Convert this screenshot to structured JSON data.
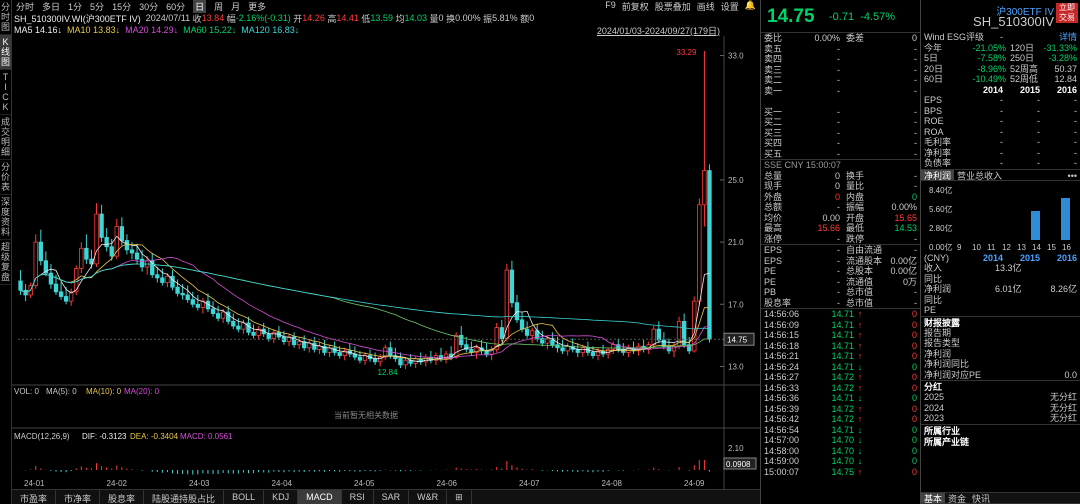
{
  "left_tabs": [
    "分时图",
    "K线图",
    "TICK",
    "成交明细",
    "分价表",
    "深度资料",
    "超级复盘"
  ],
  "topbar": {
    "periods": [
      "分时",
      "多日",
      "1分",
      "5分",
      "15分",
      "30分",
      "60分",
      "日",
      "周",
      "月",
      "更多"
    ],
    "active": "日",
    "tools": [
      "F9",
      "前复权",
      "股票叠加",
      "画线",
      "设置"
    ]
  },
  "quote_line": {
    "name": "SH_510300IV.WI(沪300ETF IV)",
    "date": "2024/07/11",
    "shou_l": "收",
    "shou": "13.84",
    "fu_l": "幅",
    "fu": "-2.16%(-0.31)",
    "kai_l": "开",
    "kai": "14.26",
    "gao_l": "高",
    "gao": "14.41",
    "di_l": "低",
    "di": "13.59",
    "jun_l": "均",
    "jun": "14.03",
    "liang_l": "量",
    "liang": "0",
    "huan_l": "换",
    "huan": "0.00%",
    "zhen_l": "振",
    "zhen": "5.81%",
    "e_l": "额",
    "e": "0"
  },
  "ma_line": {
    "ma5": "MA5 14.16↓",
    "ma10": "MA10 13.83↓",
    "ma20": "MA20 14.29↓",
    "ma60": "MA60 15.22↓",
    "ma120": "MA120 16.83↓",
    "range": "2024/01/03-2024/09/27(179日)"
  },
  "yaxis": [
    "33.0",
    "25.0",
    "21.0",
    "17.0",
    "13.0"
  ],
  "labels": {
    "hi": "33.29",
    "lo": "12.84",
    "cur": "14.75"
  },
  "vol": {
    "title": "VOL: 0",
    "ma5": "MA(5): 0",
    "ma10": "MA(10): 0",
    "ma20": "MA(20): 0",
    "empty": "当前暂无相关数据"
  },
  "macd": {
    "title": "MACD(12,26,9)",
    "dif": "DIF: -0.3123",
    "dea": "DEA: -0.3404",
    "macd": "MACD: 0.0561",
    "y1": "2.10",
    "y2": "0.0908"
  },
  "xaxis": [
    "24-01",
    "24-02",
    "24-03",
    "24-04",
    "24-05",
    "24-06",
    "24-07",
    "24-08",
    "24-09"
  ],
  "bottom_tabs": [
    "市盈率",
    "市净率",
    "股息率",
    "陆股通持股占比",
    "BOLL",
    "KDJ",
    "MACD",
    "RSI",
    "SAR",
    "W&R"
  ],
  "bottom_active": "MACD",
  "header": {
    "price": "14.75",
    "change": "-0.71",
    "pct": "-4.57%",
    "title": "沪300ETF IV",
    "code": "SH_510300IV",
    "badge": "立即交易"
  },
  "order": [
    {
      "a": "委比",
      "b": "0.00%",
      "c": "委差",
      "d": "0"
    },
    {
      "a": "卖五",
      "b": "-",
      "c": "",
      "d": "-"
    },
    {
      "a": "卖四",
      "b": "-",
      "c": "",
      "d": "-"
    },
    {
      "a": "卖三",
      "b": "-",
      "c": "",
      "d": "-"
    },
    {
      "a": "卖二",
      "b": "-",
      "c": "",
      "d": "-"
    },
    {
      "a": "卖一",
      "b": "-",
      "c": "",
      "d": "-"
    },
    {
      "a": "",
      "b": "",
      "c": "",
      "d": ""
    },
    {
      "a": "买一",
      "b": "-",
      "c": "",
      "d": "-"
    },
    {
      "a": "买二",
      "b": "-",
      "c": "",
      "d": "-"
    },
    {
      "a": "买三",
      "b": "-",
      "c": "",
      "d": "-"
    },
    {
      "a": "买四",
      "b": "-",
      "c": "",
      "d": "-"
    },
    {
      "a": "买五",
      "b": "-",
      "c": "",
      "d": "-"
    }
  ],
  "stats": [
    {
      "a": "总量",
      "b": "0",
      "c": "换手",
      "d": "-"
    },
    {
      "a": "现手",
      "b": "0",
      "c": "量比",
      "d": "-"
    },
    {
      "a": "外盘",
      "b": "0",
      "c": "内盘",
      "d": "0"
    },
    {
      "a": "总额",
      "b": "-",
      "c": "振幅",
      "d": "0.00%"
    },
    {
      "a": "均价",
      "b": "0.00",
      "c": "开盘",
      "d": "15.65"
    },
    {
      "a": "最高",
      "b": "15.66",
      "c": "最低",
      "d": "14.53"
    },
    {
      "a": "涨停",
      "b": "-",
      "c": "跌停",
      "d": "-"
    }
  ],
  "fin": [
    {
      "a": "EPS",
      "b": "-",
      "c": "自由流通",
      "d": "-"
    },
    {
      "a": "EPS",
      "b": "-",
      "c": "流通股本",
      "d": "0.00亿"
    },
    {
      "a": "PE",
      "b": "-",
      "c": "总股本",
      "d": "0.00亿"
    },
    {
      "a": "PE",
      "b": "-",
      "c": "流通值",
      "d": "0万"
    },
    {
      "a": "PB",
      "b": "-",
      "c": "总市值",
      "d": "-"
    },
    {
      "a": "股息率",
      "b": "-",
      "c": "总市值",
      "d": "-"
    }
  ],
  "ssebar": "SSE  CNY  15:00:07",
  "ticks": [
    {
      "t": "14:56:06",
      "p": "14.71",
      "a": "↑",
      "v": "0"
    },
    {
      "t": "14:56:09",
      "p": "14.71",
      "a": "↑",
      "v": "0"
    },
    {
      "t": "14:56:15",
      "p": "14.71",
      "a": "↑",
      "v": "0"
    },
    {
      "t": "14:56:18",
      "p": "14.71",
      "a": "↑",
      "v": "0"
    },
    {
      "t": "14:56:21",
      "p": "14.71",
      "a": "↑",
      "v": "0"
    },
    {
      "t": "14:56:24",
      "p": "14.71",
      "a": "↓",
      "v": "0"
    },
    {
      "t": "14:56:27",
      "p": "14.72",
      "a": "↑",
      "v": "0"
    },
    {
      "t": "14:56:33",
      "p": "14.72",
      "a": "↑",
      "v": "0"
    },
    {
      "t": "14:56:36",
      "p": "14.71",
      "a": "↓",
      "v": "0"
    },
    {
      "t": "14:56:39",
      "p": "14.72",
      "a": "↑",
      "v": "0"
    },
    {
      "t": "14:56:42",
      "p": "14.72",
      "a": "↑",
      "v": "0"
    },
    {
      "t": "14:56:54",
      "p": "14.71",
      "a": "↓",
      "v": "0"
    },
    {
      "t": "14:57:00",
      "p": "14.70",
      "a": "↓",
      "v": "0"
    },
    {
      "t": "14:58:00",
      "p": "14.70",
      "a": "↓",
      "v": "0"
    },
    {
      "t": "14:59:00",
      "p": "14.70",
      "a": "↓",
      "v": "0"
    },
    {
      "t": "15:00:07",
      "p": "14.75",
      "a": "↑",
      "v": "0"
    }
  ],
  "far": {
    "esg_label": "Wind ESG评级",
    "esg_val": "-",
    "detail": "详情",
    "perf": [
      {
        "a": "今年",
        "b": "-21.05%",
        "c": "120日",
        "d": "-31.33%"
      },
      {
        "a": "5日",
        "b": "-7.58%",
        "c": "250日",
        "d": "-3.28%"
      },
      {
        "a": "20日",
        "b": "-8.96%",
        "c": "52周高",
        "d": "50.37"
      },
      {
        "a": "60日",
        "b": "-10.49%",
        "c": "52周低",
        "d": "12.84"
      }
    ],
    "years": [
      "2014",
      "2015",
      "2016"
    ],
    "ratios": [
      "EPS",
      "BPS",
      "ROE",
      "ROA",
      "毛利率",
      "净利率",
      "负债率"
    ],
    "tabs": [
      "净利润",
      "营业总收入"
    ],
    "bar_y": [
      "8.40亿",
      "5.60亿",
      "2.80亿",
      "0.00亿"
    ],
    "bar_x": [
      "9",
      "10",
      "11",
      "12",
      "13",
      "14",
      "15",
      "16"
    ],
    "bar_vals": [
      0,
      0,
      0,
      0,
      0,
      4.4,
      0,
      6.2
    ],
    "cny": "(CNY)",
    "incl": [
      {
        "a": "收入",
        "v": "13.3亿"
      },
      {
        "a": "同比",
        "v": ""
      },
      {
        "a": "净利润",
        "v": "6.01亿",
        "v2": "8.26亿"
      },
      {
        "a": "同比",
        "v": ""
      },
      {
        "a": "PE",
        "v": ""
      }
    ],
    "disc_title": "财报披露",
    "disc": [
      {
        "a": "报告期",
        "v": ""
      },
      {
        "a": "报告类型",
        "v": ""
      },
      {
        "a": "净利润",
        "v": ""
      },
      {
        "a": "净利润同比",
        "v": ""
      },
      {
        "a": "净利润对应PE",
        "v": "0.0"
      }
    ],
    "div_title": "分红",
    "div": [
      {
        "a": "2025",
        "v": "无分红"
      },
      {
        "a": "2024",
        "v": "无分红"
      },
      {
        "a": "2023",
        "v": "无分红"
      }
    ],
    "ind_title": "所属行业",
    "chain_title": "所属产业链",
    "main_title": "主营业务",
    "btabs": [
      "基本",
      "资金",
      "快讯"
    ]
  },
  "colors": {
    "up": "#ff3b3b",
    "down": "#00d26a",
    "ma5": "#eeeeee",
    "ma10": "#e6c84c",
    "ma20": "#d64cd6",
    "ma60": "#6cc86c",
    "ma120": "#3cd6d6"
  },
  "chart_data": {
    "type": "candlestick",
    "ylim": [
      12,
      34
    ],
    "candles": [
      [
        18.5,
        19.2,
        17.6,
        17.9
      ],
      [
        17.9,
        18.3,
        17.2,
        17.6
      ],
      [
        17.6,
        18.4,
        17.4,
        18.2
      ],
      [
        18.2,
        21.5,
        18.0,
        21.0
      ],
      [
        21.0,
        21.8,
        19.5,
        19.8
      ],
      [
        19.8,
        20.4,
        18.8,
        19.0
      ],
      [
        19.0,
        19.6,
        18.0,
        18.3
      ],
      [
        18.3,
        18.9,
        17.6,
        17.8
      ],
      [
        17.8,
        18.4,
        17.3,
        17.5
      ],
      [
        17.5,
        18.1,
        17.0,
        17.2
      ],
      [
        17.2,
        18.0,
        16.9,
        17.8
      ],
      [
        17.8,
        19.5,
        17.6,
        19.3
      ],
      [
        19.3,
        21.0,
        19.0,
        20.6
      ],
      [
        20.6,
        21.5,
        19.6,
        19.9
      ],
      [
        19.9,
        20.5,
        19.3,
        19.6
      ],
      [
        19.6,
        23.5,
        19.4,
        22.8
      ],
      [
        22.8,
        23.4,
        21.0,
        21.3
      ],
      [
        21.3,
        21.9,
        20.4,
        20.7
      ],
      [
        20.7,
        21.2,
        19.8,
        20.1
      ],
      [
        20.1,
        22.5,
        19.9,
        22.0
      ],
      [
        22.0,
        22.6,
        20.8,
        21.1
      ],
      [
        21.1,
        21.5,
        20.2,
        20.5
      ],
      [
        20.5,
        21.0,
        19.9,
        20.3
      ],
      [
        20.3,
        20.9,
        19.6,
        19.9
      ],
      [
        19.9,
        20.5,
        19.1,
        19.4
      ],
      [
        19.4,
        20.1,
        18.9,
        19.8
      ],
      [
        19.8,
        20.3,
        18.7,
        18.9
      ],
      [
        18.9,
        19.4,
        18.4,
        18.7
      ],
      [
        18.7,
        19.3,
        18.2,
        18.4
      ],
      [
        18.4,
        19.0,
        18.1,
        18.8
      ],
      [
        18.8,
        19.2,
        17.9,
        18.1
      ],
      [
        18.1,
        18.6,
        17.5,
        17.7
      ],
      [
        17.7,
        18.3,
        17.3,
        17.6
      ],
      [
        17.6,
        18.2,
        17.1,
        17.3
      ],
      [
        17.3,
        17.8,
        16.8,
        17.0
      ],
      [
        17.0,
        17.6,
        16.6,
        16.8
      ],
      [
        16.8,
        17.4,
        16.4,
        17.2
      ],
      [
        17.2,
        17.7,
        16.5,
        16.7
      ],
      [
        16.7,
        17.2,
        16.2,
        16.4
      ],
      [
        16.4,
        16.9,
        15.9,
        16.1
      ],
      [
        16.1,
        16.7,
        15.8,
        16.5
      ],
      [
        16.5,
        16.9,
        15.7,
        15.9
      ],
      [
        15.9,
        16.4,
        15.4,
        15.6
      ],
      [
        15.6,
        16.1,
        15.2,
        15.4
      ],
      [
        15.4,
        16.0,
        15.1,
        15.8
      ],
      [
        15.8,
        16.2,
        15.0,
        15.2
      ],
      [
        15.2,
        15.7,
        14.8,
        15.0
      ],
      [
        15.0,
        15.6,
        14.7,
        15.4
      ],
      [
        15.4,
        15.8,
        14.9,
        15.1
      ],
      [
        15.1,
        15.5,
        14.6,
        14.8
      ],
      [
        14.8,
        15.4,
        14.5,
        15.2
      ],
      [
        15.2,
        15.6,
        14.7,
        14.9
      ],
      [
        14.9,
        15.3,
        14.4,
        14.6
      ],
      [
        14.6,
        15.1,
        14.3,
        14.9
      ],
      [
        14.9,
        15.2,
        14.2,
        14.4
      ],
      [
        14.4,
        14.9,
        14.1,
        14.6
      ],
      [
        14.6,
        15.0,
        14.0,
        14.2
      ],
      [
        14.2,
        14.7,
        13.9,
        14.5
      ],
      [
        14.5,
        14.9,
        13.9,
        14.1
      ],
      [
        14.1,
        14.6,
        13.8,
        14.3
      ],
      [
        14.3,
        14.7,
        13.7,
        13.9
      ],
      [
        13.9,
        14.4,
        13.6,
        14.2
      ],
      [
        14.2,
        14.6,
        13.7,
        13.9
      ],
      [
        13.9,
        14.3,
        13.5,
        13.7
      ],
      [
        13.7,
        14.2,
        13.4,
        14.0
      ],
      [
        14.0,
        14.5,
        13.6,
        13.8
      ],
      [
        13.8,
        14.3,
        13.4,
        13.6
      ],
      [
        13.6,
        14.0,
        13.2,
        13.4
      ],
      [
        13.4,
        13.9,
        13.1,
        13.7
      ],
      [
        13.7,
        14.1,
        13.3,
        13.5
      ],
      [
        13.5,
        13.9,
        13.1,
        13.3
      ],
      [
        13.3,
        13.8,
        13.0,
        13.6
      ],
      [
        13.6,
        14.4,
        13.4,
        14.2
      ],
      [
        14.2,
        14.6,
        13.5,
        13.7
      ],
      [
        13.7,
        14.2,
        13.3,
        13.5
      ],
      [
        13.5,
        13.9,
        12.9,
        13.1
      ],
      [
        13.1,
        13.6,
        12.84,
        13.4
      ],
      [
        13.4,
        13.8,
        13.0,
        13.2
      ],
      [
        13.2,
        13.7,
        12.9,
        13.5
      ],
      [
        13.5,
        13.9,
        13.1,
        13.3
      ],
      [
        13.3,
        13.8,
        13.0,
        13.6
      ],
      [
        13.6,
        14.0,
        13.2,
        13.4
      ],
      [
        13.4,
        13.9,
        13.1,
        13.7
      ],
      [
        13.7,
        14.2,
        13.3,
        13.5
      ],
      [
        13.5,
        14.0,
        13.2,
        13.8
      ],
      [
        13.8,
        14.3,
        13.4,
        13.6
      ],
      [
        13.6,
        15.2,
        13.5,
        15.0
      ],
      [
        15.0,
        15.6,
        14.2,
        14.4
      ],
      [
        14.4,
        14.9,
        13.9,
        14.1
      ],
      [
        14.1,
        14.6,
        13.7,
        13.9
      ],
      [
        13.9,
        14.4,
        13.5,
        14.2
      ],
      [
        14.2,
        14.7,
        13.8,
        14.0
      ],
      [
        14.0,
        14.5,
        13.6,
        13.8
      ],
      [
        13.8,
        14.3,
        13.4,
        14.1
      ],
      [
        14.1,
        15.8,
        13.9,
        15.5
      ],
      [
        15.5,
        16.0,
        14.6,
        14.8
      ],
      [
        14.8,
        19.6,
        14.6,
        19.2
      ],
      [
        19.2,
        19.8,
        16.8,
        17.1
      ],
      [
        17.1,
        17.6,
        15.8,
        16.0
      ],
      [
        16.0,
        16.5,
        15.2,
        15.4
      ],
      [
        15.4,
        15.9,
        14.8,
        15.0
      ],
      [
        15.0,
        15.5,
        14.5,
        15.3
      ],
      [
        15.3,
        15.7,
        14.6,
        14.8
      ],
      [
        14.8,
        15.3,
        14.3,
        14.5
      ],
      [
        14.5,
        15.0,
        14.1,
        14.8
      ],
      [
        14.8,
        15.2,
        14.2,
        14.4
      ],
      [
        14.4,
        14.9,
        13.9,
        14.2
      ],
      [
        14.2,
        14.7,
        13.8,
        14.0
      ],
      [
        14.0,
        14.5,
        13.7,
        14.3
      ],
      [
        14.3,
        14.8,
        13.9,
        14.1
      ],
      [
        14.1,
        14.5,
        13.6,
        13.9
      ],
      [
        13.9,
        14.4,
        13.6,
        14.2
      ],
      [
        14.2,
        14.6,
        13.7,
        13.9
      ],
      [
        13.9,
        14.3,
        13.5,
        13.7
      ],
      [
        13.7,
        14.2,
        13.4,
        14.0
      ],
      [
        14.0,
        14.4,
        13.6,
        13.8
      ],
      [
        13.8,
        14.2,
        13.5,
        14.1
      ],
      [
        14.1,
        14.6,
        13.8,
        14.4
      ],
      [
        14.4,
        14.8,
        13.9,
        14.1
      ],
      [
        14.1,
        14.5,
        13.7,
        13.9
      ],
      [
        13.9,
        14.4,
        13.6,
        14.2
      ],
      [
        14.2,
        14.6,
        13.8,
        14.0
      ],
      [
        14.0,
        14.5,
        13.7,
        14.3
      ],
      [
        14.3,
        14.7,
        13.9,
        14.1
      ],
      [
        14.1,
        14.6,
        13.8,
        14.4
      ],
      [
        14.4,
        15.6,
        14.2,
        15.4
      ],
      [
        15.4,
        15.9,
        14.5,
        14.7
      ],
      [
        14.7,
        15.2,
        14.1,
        14.3
      ],
      [
        14.3,
        14.8,
        13.8,
        14.0
      ],
      [
        14.0,
        14.5,
        13.6,
        14.3
      ],
      [
        14.3,
        16.2,
        14.1,
        15.9
      ],
      [
        15.9,
        16.4,
        14.2,
        14.4
      ],
      [
        14.4,
        14.9,
        13.8,
        14.0
      ],
      [
        14.0,
        17.5,
        13.9,
        17.2
      ],
      [
        17.2,
        23.8,
        16.9,
        23.4
      ],
      [
        23.4,
        33.29,
        22.0,
        25.6
      ],
      [
        25.6,
        26.0,
        14.53,
        14.75
      ]
    ],
    "ma_lines": {
      "ma5": "white",
      "ma10": "yellow",
      "ma20": "magenta",
      "ma60": "green",
      "ma120": "cyan"
    }
  }
}
